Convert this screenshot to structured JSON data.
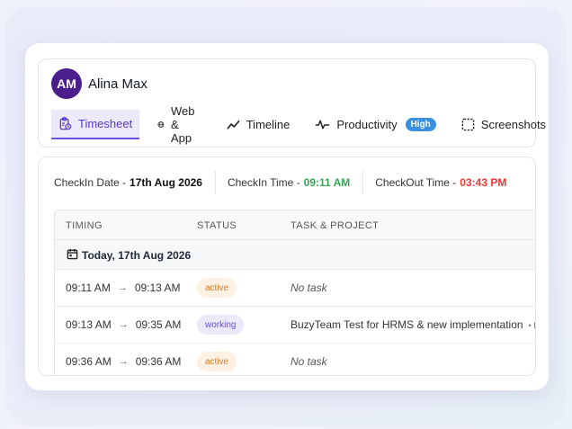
{
  "user": {
    "initials": "AM",
    "name": "Alina Max"
  },
  "tabs": [
    {
      "label": "Timesheet",
      "icon": "clipboard-icon",
      "active": true
    },
    {
      "label": "Web & App",
      "icon": "globe-icon"
    },
    {
      "label": "Timeline",
      "icon": "trend-line-icon"
    },
    {
      "label": "Productivity",
      "icon": "pulse-icon",
      "badge": "High"
    },
    {
      "label": "Screenshots",
      "icon": "screenshot-frame-icon"
    }
  ],
  "checks": {
    "date_label": "CheckIn Date -",
    "date_value": "17th Aug 2026",
    "in_label": "CheckIn Time -",
    "in_value": "09:11 AM",
    "out_label": "CheckOut Time -",
    "out_value": "03:43 PM"
  },
  "table": {
    "headers": {
      "timing": "TIMING",
      "status": "STATUS",
      "task": "TASK & PROJECT"
    },
    "group_label": "Today, 17th Aug 2026",
    "rows": [
      {
        "start": "09:11 AM",
        "end": "09:13 AM",
        "status": "active",
        "task": "No task",
        "project": ""
      },
      {
        "start": "09:13 AM",
        "end": "09:35 AM",
        "status": "working",
        "task": "BuzyTeam Test for HRMS & new implementation",
        "project": "• Buzy T"
      },
      {
        "start": "09:36 AM",
        "end": "09:36 AM",
        "status": "active",
        "task": "No task",
        "project": ""
      }
    ]
  },
  "colors": {
    "accent": "#6d4fe0",
    "checkin": "#34a853",
    "checkout": "#e53935",
    "badge": "#3b8fe0"
  }
}
